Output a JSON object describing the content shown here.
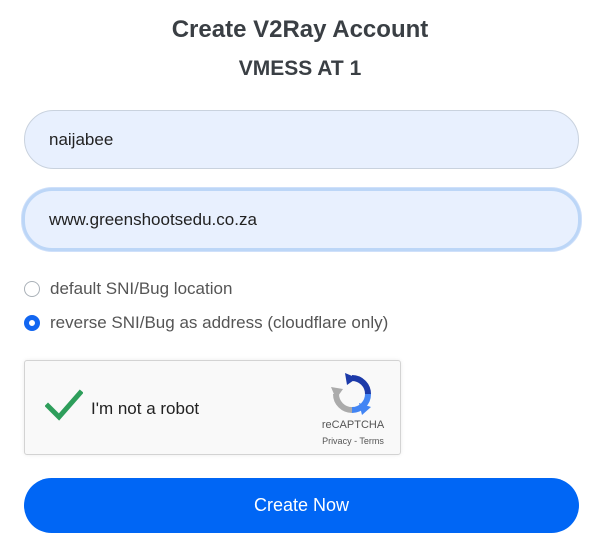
{
  "header": {
    "title": "Create V2Ray Account",
    "subtitle": "VMESS AT 1"
  },
  "form": {
    "username": {
      "value": "naijabee"
    },
    "sni": {
      "value": "www.greenshootsedu.co.za"
    },
    "options": [
      {
        "label": "default SNI/Bug location",
        "checked": false
      },
      {
        "label": "reverse SNI/Bug as address (cloudflare only)",
        "checked": true
      }
    ]
  },
  "captcha": {
    "label": "I'm not a robot",
    "brand": "reCAPTCHA",
    "privacy": "Privacy",
    "separator": " - ",
    "terms": "Terms",
    "checked": true
  },
  "submit": {
    "label": "Create Now"
  },
  "colors": {
    "accent": "#0066f5",
    "field_bg": "#e8f0fe",
    "check_green": "#2e9e5b"
  }
}
